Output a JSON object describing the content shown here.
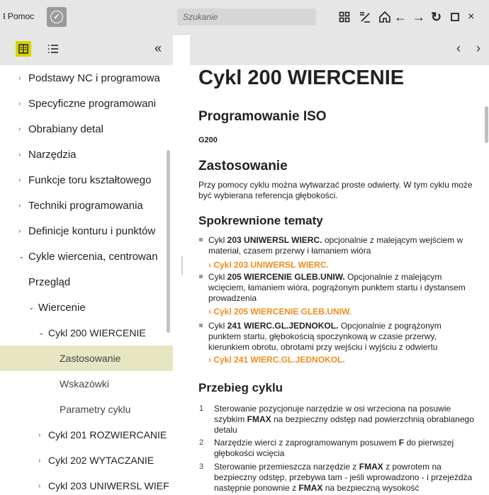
{
  "topbar": {
    "app_dots": "⁝",
    "app_title": "Pomoc",
    "search_placeholder": "Szukanie"
  },
  "colors": {
    "accent": "#d4d400",
    "link": "#f08c1e",
    "selected_bg": "#e6e6c2",
    "bar_bg": "#e6e6e6"
  },
  "sidebar": {
    "collapse_label": "«",
    "items": [
      {
        "label": "Podstawy NC i programowa",
        "arrow": "›"
      },
      {
        "label": "Specyficzne programowani",
        "arrow": "›"
      },
      {
        "label": "Obrabiany detal",
        "arrow": "›"
      },
      {
        "label": "Narzędzia",
        "arrow": "›"
      },
      {
        "label": "Funkcje toru kształtowego",
        "arrow": "›"
      },
      {
        "label": "Techniki programowania",
        "arrow": "›"
      },
      {
        "label": "Definicje konturu i punktów",
        "arrow": "›"
      },
      {
        "label": "Cykle wiercenia, centrowan",
        "arrow": "⌄"
      },
      {
        "label": "Przegląd",
        "arrow": ""
      },
      {
        "label": "Wiercenie",
        "arrow": "⌄"
      },
      {
        "label": "Cykl 200 WIERCENIE",
        "arrow": "⌄"
      },
      {
        "label": "Zastosowanie",
        "arrow": ""
      },
      {
        "label": "Wskazówki",
        "arrow": ""
      },
      {
        "label": "Parametry cyklu",
        "arrow": ""
      },
      {
        "label": "Cykl 201 ROZWIERCANIE",
        "arrow": "›"
      },
      {
        "label": "Cykl 202 WYTACZANIE",
        "arrow": "›"
      },
      {
        "label": "Cykl 203 UNIWERSL WIEF",
        "arrow": "›"
      }
    ]
  },
  "content": {
    "title": "Cykl 200 WIERCENIE",
    "iso_heading": "Programowanie ISO",
    "iso_code": "G200",
    "usage_heading": "Zastosowanie",
    "usage_text": "Przy pomocy cyklu można wytwarzać proste odwierty. W tym cyklu może być wybierana referencja głębokości.",
    "related_heading": "Spokrewnione tematy",
    "related": [
      {
        "pre": "Cykl ",
        "bold": "203 UNIWERSL WIERC.",
        "post": " opcjonalnie z malejącym wejściem w materiał, czasem przerwy i łamaniem wióra",
        "link": "Cykl 203 UNIWERSL WIERC."
      },
      {
        "pre": "Cykl ",
        "bold": "205 WIERCENIE GLEB.UNIW.",
        "post": " Opcjonalnie z malejącym wcięciem, łamaniem wióra, pogrążonym punktem startu i dystansem prowadzenia",
        "link": "Cykl 205 WIERCENIE GLEB.UNIW."
      },
      {
        "pre": "Cykl ",
        "bold": "241 WIERC.GL.JEDNOKOL.",
        "post": " Opcjonalnie z pogrążonym punktem startu, głębokością spoczynkową w czasie przerwy, kierunkiem obrotu, obrotami przy wejściu i wyjściu z odwiertu",
        "link": "Cykl 241 WIERC.GL.JEDNOKOL."
      }
    ],
    "link_arrow": "›",
    "sequence_heading": "Przebieg cyklu",
    "steps": [
      {
        "num": "1",
        "p1": "Sterowanie pozycjonuje narzędzie w osi wrzeciona na posuwie szybkim ",
        "b1": "FMAX",
        "p2": " na bezpieczny odstęp nad powierzchnią obrabianego detalu"
      },
      {
        "num": "2",
        "p1": "Narzędzie wierci z zaprogramowanym posuwem ",
        "b1": "F",
        "p2": " do pierwszej głębokości wcięcia"
      },
      {
        "num": "3",
        "p1": "Sterowanie przemieszcza narzędzie z ",
        "b1": "FMAX",
        "p2": " z powrotem na bezpieczny odstęp, przebywa tam - jeśli wprowadzono - i przejeżdża następnie ponownie z ",
        "b2": "FMAX",
        "p3": " na bezpieczną wysokość"
      }
    ]
  }
}
